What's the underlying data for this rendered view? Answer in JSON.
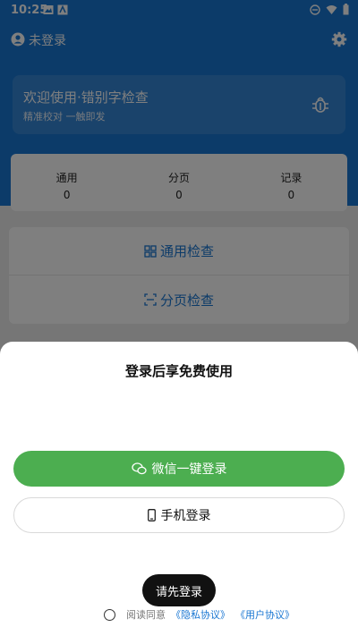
{
  "status": {
    "time": "10:25"
  },
  "topbar": {
    "user_label": "未登录"
  },
  "welcome": {
    "title": "欢迎使用·错别字检查",
    "subtitle": "精准校对 一触即发"
  },
  "stats": [
    {
      "label": "通用",
      "value": "0"
    },
    {
      "label": "分页",
      "value": "0"
    },
    {
      "label": "记录",
      "value": "0"
    }
  ],
  "actions": {
    "general_check": "通用检查",
    "page_check": "分页检查"
  },
  "sheet": {
    "title": "登录后享免费使用",
    "wechat_login": "微信一键登录",
    "phone_login": "手机登录",
    "toast": "请先登录",
    "agree_prefix": "阅读同意",
    "privacy_link": "《隐私协议》",
    "user_link": "《用户协议》"
  },
  "colors": {
    "primary": "#1976d2",
    "wechat": "#4cae50"
  }
}
